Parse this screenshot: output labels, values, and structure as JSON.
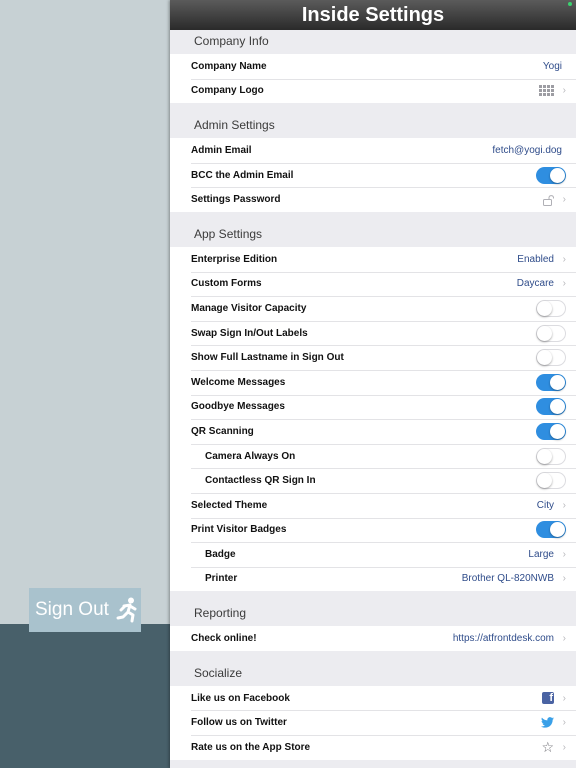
{
  "left": {
    "signout_label": "Sign Out"
  },
  "header": {
    "title": "Inside Settings"
  },
  "sections": {
    "company": {
      "title": "Company Info",
      "company_name": {
        "label": "Company Name",
        "value": "Yogi"
      },
      "company_logo": {
        "label": "Company Logo",
        "icon": "grid-icon"
      }
    },
    "admin": {
      "title": "Admin Settings",
      "admin_email": {
        "label": "Admin Email",
        "value": "fetch@yogi.dog"
      },
      "bcc": {
        "label": "BCC the Admin Email",
        "on": true
      },
      "password": {
        "label": "Settings Password",
        "icon": "unlock-icon"
      }
    },
    "app": {
      "title": "App Settings",
      "enterprise": {
        "label": "Enterprise Edition",
        "value": "Enabled"
      },
      "custom_forms": {
        "label": "Custom Forms",
        "value": "Daycare"
      },
      "visitor_capacity": {
        "label": "Manage Visitor Capacity",
        "on": false
      },
      "swap_labels": {
        "label": "Swap Sign In/Out Labels",
        "on": false
      },
      "full_lastname": {
        "label": "Show Full Lastname in Sign Out",
        "on": false
      },
      "welcome": {
        "label": "Welcome Messages",
        "on": true
      },
      "goodbye": {
        "label": "Goodbye Messages",
        "on": true
      },
      "qr": {
        "label": "QR Scanning",
        "on": true
      },
      "camera": {
        "label": "Camera Always On",
        "on": false
      },
      "contactless": {
        "label": "Contactless QR Sign In",
        "on": false
      },
      "theme": {
        "label": "Selected Theme",
        "value": "City"
      },
      "badges": {
        "label": "Print Visitor Badges",
        "on": true
      },
      "badge": {
        "label": "Badge",
        "value": "Large"
      },
      "printer": {
        "label": "Printer",
        "value": "Brother QL-820NWB"
      }
    },
    "reporting": {
      "title": "Reporting",
      "online": {
        "label": "Check online!",
        "value": "https://atfrontdesk.com"
      }
    },
    "socialize": {
      "title": "Socialize",
      "facebook": {
        "label": "Like us on Facebook"
      },
      "twitter": {
        "label": "Follow us on Twitter"
      },
      "appstore": {
        "label": "Rate us on the App Store"
      }
    }
  },
  "colors": {
    "accent": "#2f8ee0",
    "value_text": "#2f4c8a",
    "sidebar_bottom": "#48606a"
  }
}
